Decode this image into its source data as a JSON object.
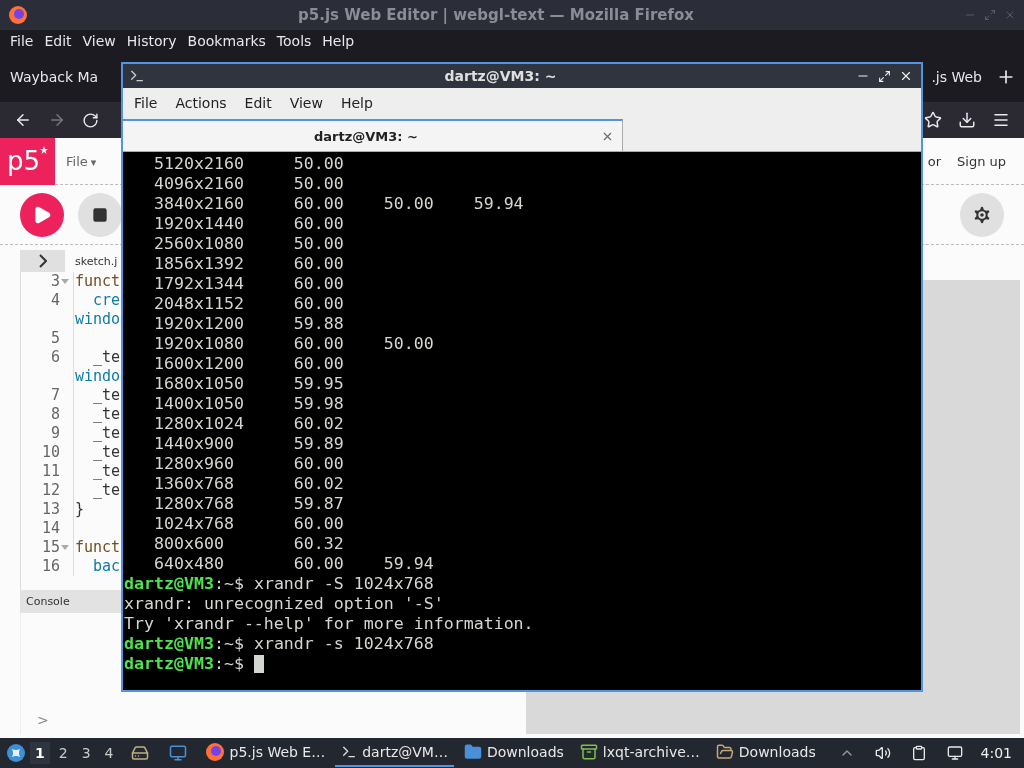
{
  "firefox": {
    "title": "p5.js Web Editor | webgl-text — Mozilla Firefox",
    "menu": [
      "File",
      "Edit",
      "View",
      "History",
      "Bookmarks",
      "Tools",
      "Help"
    ],
    "tabs": [
      "Wayback Ma",
      ".js Web"
    ],
    "page": {
      "logo": "p5",
      "file_menu": "File",
      "file_menu_caret": "▾",
      "auth": [
        "or",
        "Sign up"
      ],
      "sketch_tab": "sketch.j",
      "code": [
        {
          "number": "3",
          "fold": true,
          "kind": "keyword",
          "text": "funct"
        },
        {
          "number": "4",
          "fold": false,
          "kind": "call",
          "text": "  cre"
        },
        {
          "fold": false,
          "kind": "call",
          "text": "windo"
        },
        {
          "number": "5",
          "fold": false
        },
        {
          "number": "6",
          "fold": false,
          "kind": "plain",
          "text": "  _te"
        },
        {
          "fold": false,
          "kind": "call",
          "text": "windo"
        },
        {
          "number": "7",
          "fold": false,
          "kind": "plain",
          "text": "  _te"
        },
        {
          "number": "8",
          "fold": false,
          "kind": "plain",
          "text": "  _te"
        },
        {
          "number": "9",
          "fold": false,
          "kind": "plain",
          "text": "  _te"
        },
        {
          "number": "10",
          "fold": false,
          "kind": "plain",
          "text": "  _te"
        },
        {
          "number": "11",
          "fold": false,
          "kind": "plain",
          "text": "  _te"
        },
        {
          "number": "12",
          "fold": false,
          "kind": "plain",
          "text": "  _te"
        },
        {
          "number": "13",
          "fold": false,
          "kind": "plain",
          "text": "}"
        },
        {
          "number": "14",
          "fold": false
        },
        {
          "number": "15",
          "fold": true,
          "kind": "keyword",
          "text": "funct"
        },
        {
          "number": "16",
          "fold": false,
          "kind": "call",
          "text": "  bac"
        }
      ],
      "console": "Console",
      "prompt": ">"
    }
  },
  "terminal": {
    "title": "dartz@VM3: ~",
    "menu": [
      "File",
      "Actions",
      "Edit",
      "View",
      "Help"
    ],
    "tab": "dartz@VM3: ~",
    "lines": [
      {
        "kind": "output",
        "text": "   5120x2160     50.00"
      },
      {
        "kind": "output",
        "text": "   4096x2160     50.00"
      },
      {
        "kind": "output",
        "text": "   3840x2160     60.00    50.00    59.94"
      },
      {
        "kind": "output",
        "text": "   1920x1440     60.00"
      },
      {
        "kind": "output",
        "text": "   2560x1080     50.00"
      },
      {
        "kind": "output",
        "text": "   1856x1392     60.00"
      },
      {
        "kind": "output",
        "text": "   1792x1344     60.00"
      },
      {
        "kind": "output",
        "text": "   2048x1152     60.00"
      },
      {
        "kind": "output",
        "text": "   1920x1200     59.88"
      },
      {
        "kind": "output",
        "text": "   1920x1080     60.00    50.00"
      },
      {
        "kind": "output",
        "text": "   1600x1200     60.00"
      },
      {
        "kind": "output",
        "text": "   1680x1050     59.95"
      },
      {
        "kind": "output",
        "text": "   1400x1050     59.98"
      },
      {
        "kind": "output",
        "text": "   1280x1024     60.02"
      },
      {
        "kind": "output",
        "text": "   1440x900      59.89"
      },
      {
        "kind": "output",
        "text": "   1280x960      60.00"
      },
      {
        "kind": "output",
        "text": "   1360x768      60.02"
      },
      {
        "kind": "output",
        "text": "   1280x768      59.87"
      },
      {
        "kind": "output",
        "text": "   1024x768      60.00"
      },
      {
        "kind": "output",
        "text": "   800x600       60.32"
      },
      {
        "kind": "output",
        "text": "   640x480       60.00    59.94"
      },
      {
        "kind": "prompt",
        "user": "dartz@VM3",
        "path": ":~$",
        "text": "xrandr -S 1024x768"
      },
      {
        "kind": "output",
        "text": "xrandr: unrecognized option '-S'"
      },
      {
        "kind": "output",
        "text": "Try 'xrandr --help' for more information."
      },
      {
        "kind": "prompt",
        "user": "dartz@VM3",
        "path": ":~$",
        "text": "xrandr -s 1024x768"
      },
      {
        "kind": "prompt",
        "user": "dartz@VM3",
        "path": ":~$",
        "cursor": true
      }
    ]
  },
  "taskbar": {
    "workspaces": [
      {
        "label": "1",
        "selected": true
      },
      {
        "label": "2",
        "selected": false
      },
      {
        "label": "3",
        "selected": false
      },
      {
        "label": "4",
        "selected": false
      }
    ],
    "tasks": [
      {
        "kind": "browser",
        "label": "p5.js Web E…",
        "selected": false
      },
      {
        "kind": "terminal",
        "label": "dartz@VM…",
        "selected": true
      },
      {
        "kind": "folder",
        "label": "Downloads",
        "selected": false
      },
      {
        "kind": "archive",
        "label": "lxqt-archive…",
        "selected": false
      },
      {
        "kind": "folder-open",
        "label": "Downloads",
        "selected": false
      }
    ],
    "clock": "4:01"
  }
}
